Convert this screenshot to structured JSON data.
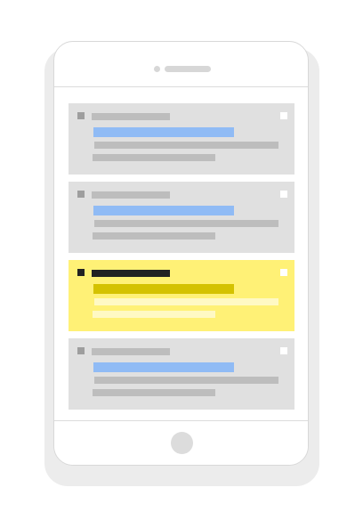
{
  "screen": {
    "type": "phone-wireframe",
    "colors": {
      "card": "#e0e0e0",
      "card_selected": "#fff176",
      "accent_line": "#90bbf5",
      "accent_line_selected": "#d4c200",
      "placeholder": "#bdbdbd"
    }
  },
  "list": {
    "items": [
      {
        "selected": false,
        "icons": [
          "square-icon",
          "checkbox-icon"
        ]
      },
      {
        "selected": false,
        "icons": [
          "square-icon",
          "checkbox-icon"
        ]
      },
      {
        "selected": true,
        "icons": [
          "square-icon",
          "checkbox-icon"
        ]
      },
      {
        "selected": false,
        "icons": [
          "square-icon",
          "checkbox-icon"
        ]
      }
    ]
  },
  "phone": {
    "icons": [
      "camera-icon",
      "speaker-icon",
      "home-button-icon"
    ]
  }
}
